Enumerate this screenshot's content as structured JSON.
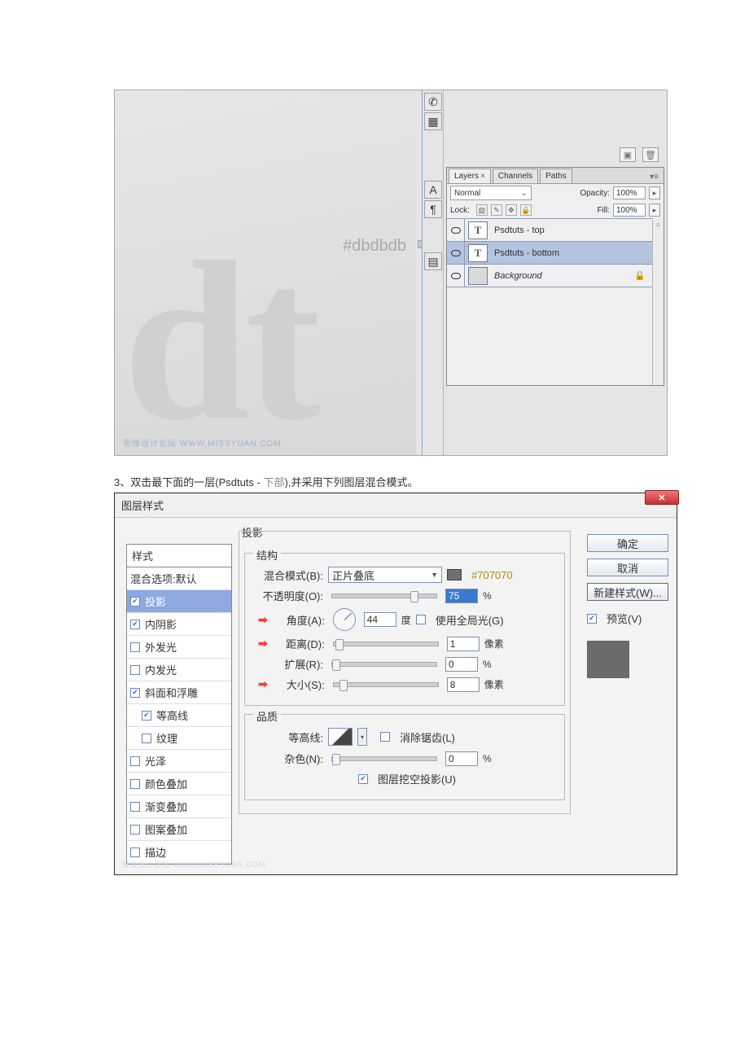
{
  "top": {
    "hex": "#dbdbdb",
    "watermark": "思缘设计论坛  WWW.MISSYUAN.COM",
    "tools": [
      "✆",
      "▦",
      "A",
      "¶",
      "▤"
    ],
    "panel_btns": [
      "▣",
      "🗑"
    ],
    "tabs": {
      "layers": "Layers",
      "channels": "Channels",
      "paths": "Paths"
    },
    "blend_mode": "Normal",
    "opacity_label": "Opacity:",
    "opacity_value": "100%",
    "lock_label": "Lock:",
    "fill_label": "Fill:",
    "fill_value": "100%",
    "layers": [
      {
        "name": "Psdtuts - top",
        "type": "T",
        "selected": false
      },
      {
        "name": "Psdtuts - bottom",
        "type": "T",
        "selected": true
      },
      {
        "name": "Background",
        "type": "bg",
        "selected": false,
        "locked": true
      }
    ]
  },
  "caption": {
    "num": "3、",
    "a": "双击最下面的一层(Psdtuts  - ",
    "b": "下部",
    "c": "),并采用下列图层混合模式。"
  },
  "dlg": {
    "title": "图层样式",
    "styles_header": "样式",
    "styles": [
      {
        "label": "混合选项:默认",
        "checked": null
      },
      {
        "label": "投影",
        "checked": true,
        "selected": true
      },
      {
        "label": "内阴影",
        "checked": true
      },
      {
        "label": "外发光",
        "checked": false
      },
      {
        "label": "内发光",
        "checked": false
      },
      {
        "label": "斜面和浮雕",
        "checked": true
      },
      {
        "label": "等高线",
        "checked": true,
        "indent": true
      },
      {
        "label": "纹理",
        "checked": false,
        "indent": true
      },
      {
        "label": "光泽",
        "checked": false
      },
      {
        "label": "颜色叠加",
        "checked": false
      },
      {
        "label": "渐变叠加",
        "checked": false
      },
      {
        "label": "图案叠加",
        "checked": false
      },
      {
        "label": "描边",
        "checked": false
      }
    ],
    "section_title": "投影",
    "struct_title": "结构",
    "blend_label": "混合模式(B):",
    "blend_value": "正片叠底",
    "color_hex": "#707070",
    "opacity_label": "不透明度(O):",
    "opacity_value": "75",
    "opacity_unit": "%",
    "angle_label": "角度(A):",
    "angle_value": "44",
    "angle_unit": "度",
    "global_label": "使用全局光(G)",
    "distance_label": "距离(D):",
    "distance_value": "1",
    "distance_unit": "像素",
    "spread_label": "扩展(R):",
    "spread_value": "0",
    "spread_unit": "%",
    "size_label": "大小(S):",
    "size_value": "8",
    "size_unit": "像素",
    "quality_title": "品质",
    "contour_label": "等高线:",
    "antialias_label": "消除锯齿(L)",
    "noise_label": "杂色(N):",
    "noise_value": "0",
    "noise_unit": "%",
    "knockout_label": "图层挖空投影(U)",
    "buttons": {
      "ok": "确定",
      "cancel": "取消",
      "new": "新建样式(W)..."
    },
    "preview_label": "预览(V)",
    "watermark": "思缘设计论坛  WWW.MISSYUAN.COM"
  }
}
